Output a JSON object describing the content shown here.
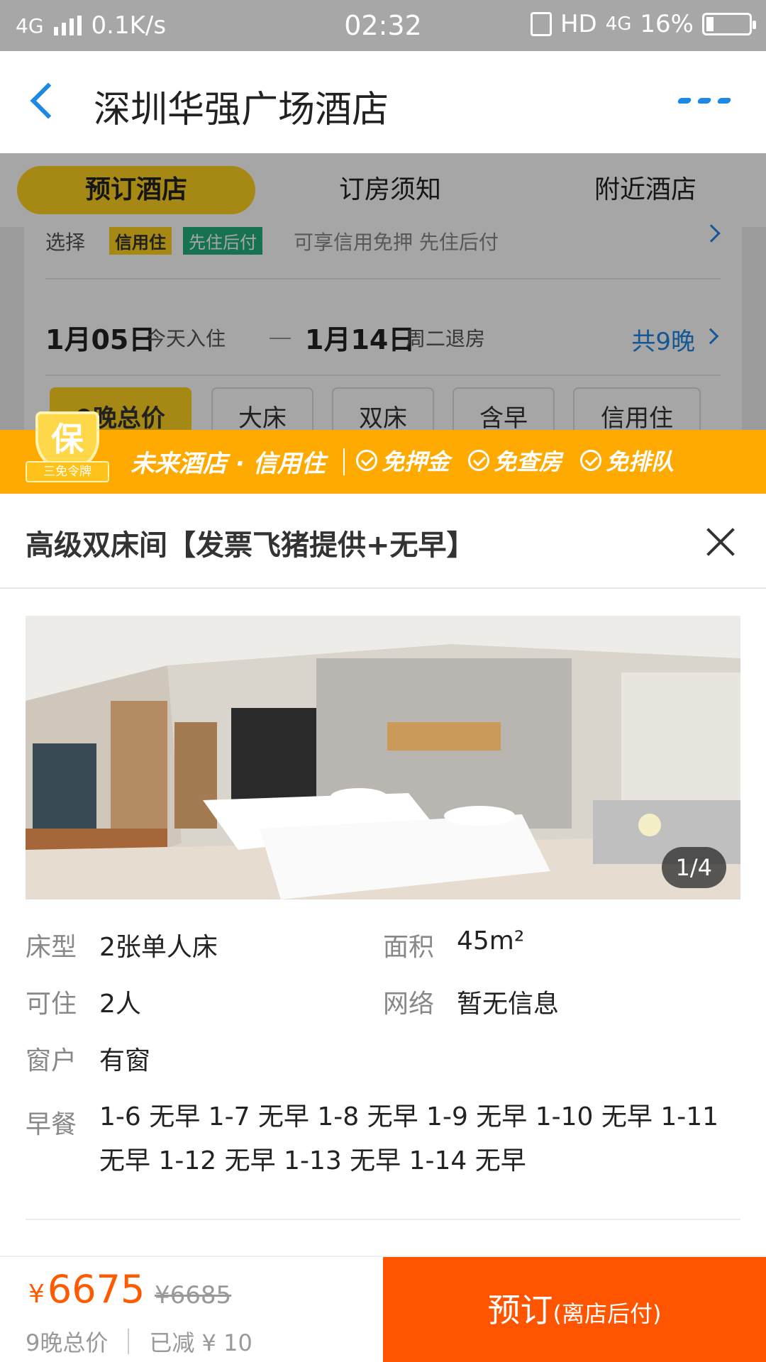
{
  "status_bar": {
    "network": "4G",
    "speed": "0.1K/s",
    "time": "02:32",
    "hd": "HD",
    "net4g": "4G",
    "battery": "16%"
  },
  "nav": {
    "title": "深圳华强广场酒店",
    "back_icon": "chevron-left-icon",
    "more_icon": "more-dots-icon"
  },
  "tabs": [
    "预订酒店",
    "订房须知",
    "附近酒店"
  ],
  "background_card": {
    "credit_label": "选择",
    "credit_tag1": "信用住",
    "credit_tag2": "先住后付",
    "credit_desc": "可享信用免押 先住后付",
    "checkin_date": "1月05日",
    "checkin_note": "今天入住",
    "checkout_date": "1月14日",
    "checkout_note": "周二退房",
    "nights": "共9晚",
    "filters": [
      "9晚总价",
      "大床",
      "双床",
      "含早",
      "信用住"
    ]
  },
  "banner": {
    "badge_char": "保",
    "badge_ribbon": "三免令牌",
    "brand": "未来酒店 · 信用住",
    "perks": [
      "免押金",
      "免查房",
      "免排队"
    ],
    "background": "#ffaa00"
  },
  "room": {
    "title": "高级双床间【发票飞猪提供+无早】",
    "photo_counter": "1/4",
    "attributes": {
      "bed_type_label": "床型",
      "bed_type": "2张单人床",
      "area_label": "面积",
      "area": "45m²",
      "capacity_label": "可住",
      "capacity": "2人",
      "network_label": "网络",
      "network": "暂无信息",
      "window_label": "窗户",
      "window": "有窗",
      "breakfast_label": "早餐",
      "breakfast": "1-6 无早 1-7 无早 1-8 无早 1-9 无早 1-10 无早 1-11 无早 1-12 无早 1-13 无早 1-14 无早"
    }
  },
  "bottom": {
    "currency": "¥",
    "price": "6675",
    "original_price": "¥6685",
    "price_note": "9晚总价",
    "discount": "已减 ¥ 10",
    "book_label": "预订",
    "book_note": "(离店后付)",
    "accent": "#ff5500"
  }
}
